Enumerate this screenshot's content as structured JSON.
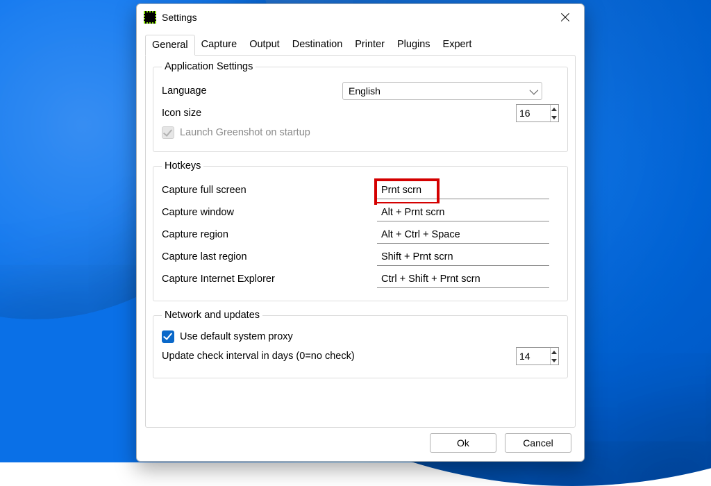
{
  "window": {
    "title": "Settings"
  },
  "tabs": [
    {
      "label": "General",
      "active": true
    },
    {
      "label": "Capture",
      "active": false
    },
    {
      "label": "Output",
      "active": false
    },
    {
      "label": "Destination",
      "active": false
    },
    {
      "label": "Printer",
      "active": false
    },
    {
      "label": "Plugins",
      "active": false
    },
    {
      "label": "Expert",
      "active": false
    }
  ],
  "groups": {
    "app": {
      "legend": "Application Settings",
      "language_label": "Language",
      "language_value": "English",
      "iconsize_label": "Icon size",
      "iconsize_value": "16",
      "launch_label": "Launch Greenshot on startup",
      "launch_checked": true,
      "launch_enabled": false
    },
    "hotkeys": {
      "legend": "Hotkeys",
      "items": [
        {
          "label": "Capture full screen",
          "value": "Prnt scrn",
          "highlight": true
        },
        {
          "label": "Capture window",
          "value": "Alt + Prnt scrn",
          "highlight": false
        },
        {
          "label": "Capture region",
          "value": "Alt + Ctrl + Space",
          "highlight": false
        },
        {
          "label": "Capture last region",
          "value": "Shift + Prnt scrn",
          "highlight": false
        },
        {
          "label": "Capture Internet Explorer",
          "value": "Ctrl + Shift + Prnt scrn",
          "highlight": false
        }
      ]
    },
    "network": {
      "legend": "Network and updates",
      "proxy_label": "Use default system proxy",
      "proxy_checked": true,
      "interval_label": "Update check interval in days (0=no check)",
      "interval_value": "14"
    }
  },
  "footer": {
    "ok": "Ok",
    "cancel": "Cancel"
  }
}
